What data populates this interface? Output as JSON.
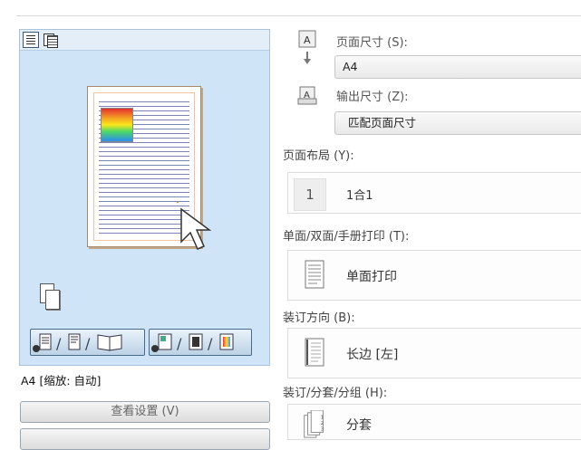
{
  "preview": {
    "status_text": "A4 [缩放: 自动]",
    "view_settings_button": "查看设置 (V)",
    "layout_mode_group_1": [
      "/",
      "/"
    ],
    "layout_mode_group_2": [
      "/",
      "/"
    ]
  },
  "page_size": {
    "label": "页面尺寸 (S):",
    "value": "A4"
  },
  "output_size": {
    "label": "输出尺寸 (Z):",
    "value": "匹配页面尺寸"
  },
  "page_layout": {
    "label": "页面布局 (Y):",
    "icon_number": "1",
    "value": "1合1"
  },
  "print_style": {
    "label": "单面/双面/手册打印 (T):",
    "value": "单面打印"
  },
  "binding": {
    "label": "装订方向 (B):",
    "value": "长边 [左]"
  },
  "finishing": {
    "label": "装订/分套/分组 (H):",
    "value": "分套"
  },
  "colors": {
    "preview_bg": "#cfe5f7",
    "paper_border": "#a8896a",
    "arrow_accent": "#f08a1c"
  }
}
